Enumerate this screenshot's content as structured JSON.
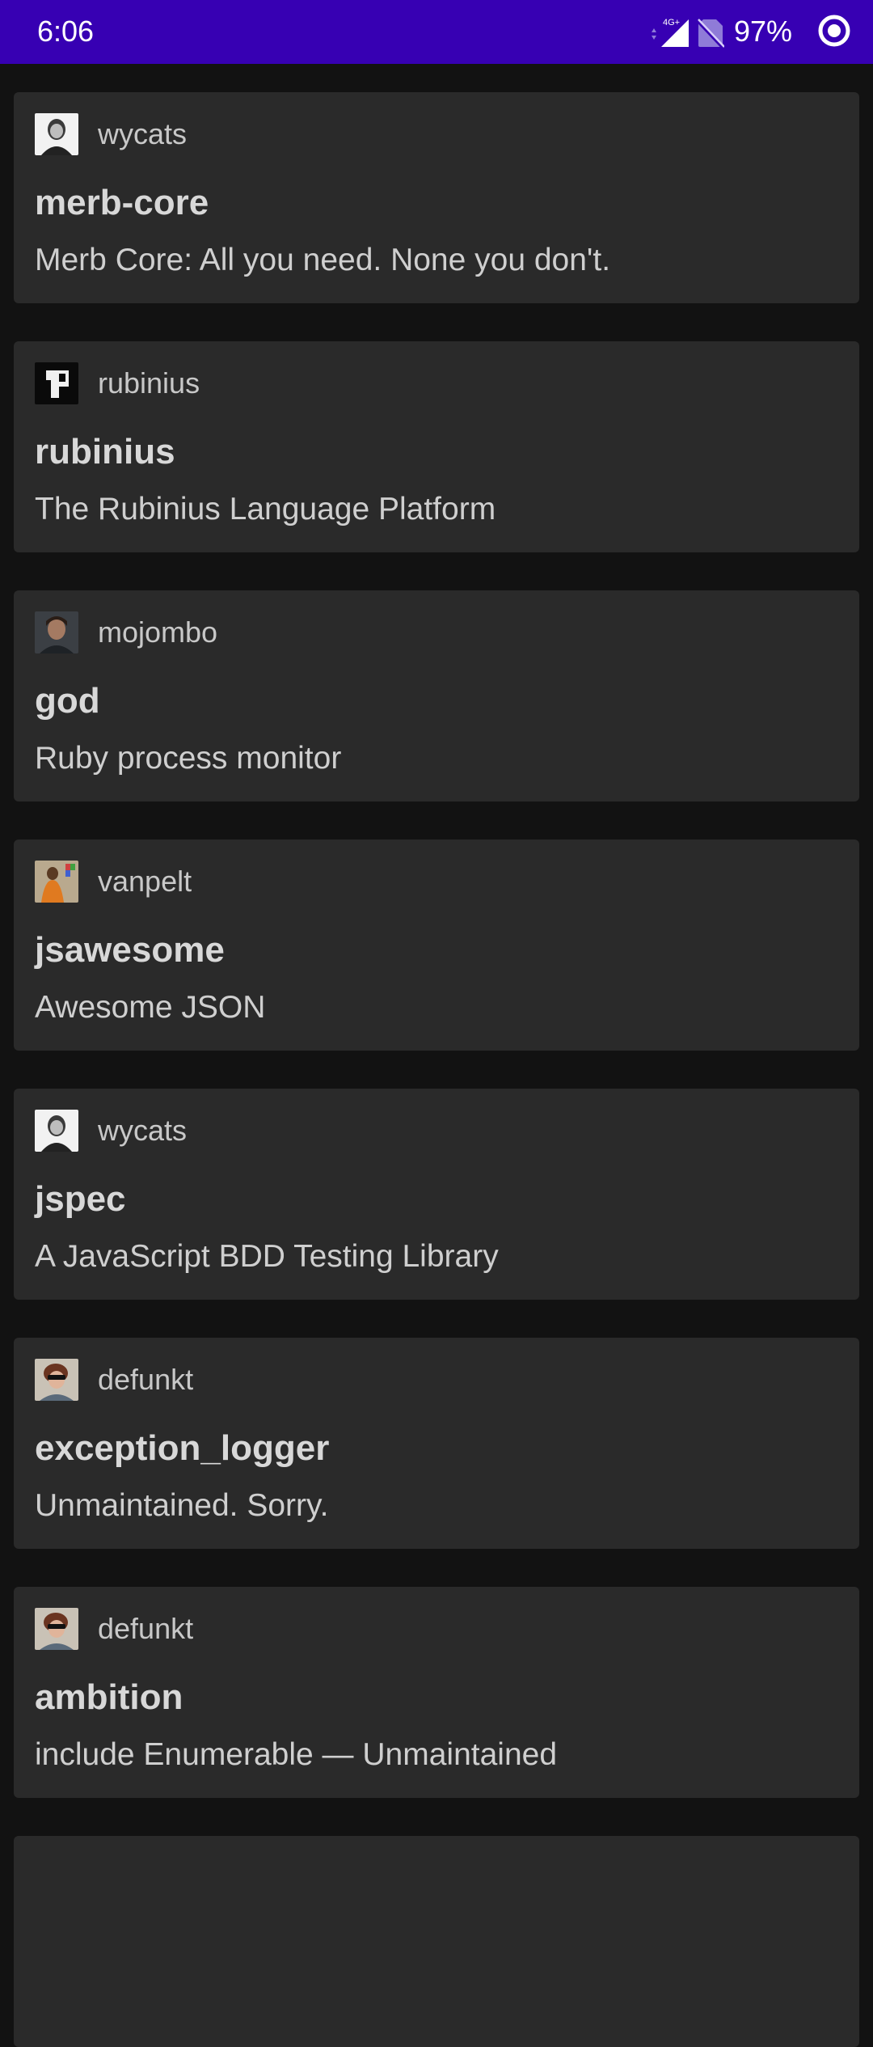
{
  "status_bar": {
    "time": "6:06",
    "network_label": "4G+",
    "battery_percent": "97%",
    "icons": [
      "signal-icon",
      "sim-off-icon",
      "ring-icon"
    ]
  },
  "repos": [
    {
      "owner": "wycats",
      "name": "merb-core",
      "description": "Merb Core: All you need. None you don't.",
      "avatar_icon": "wycats-avatar"
    },
    {
      "owner": "rubinius",
      "name": "rubinius",
      "description": "The Rubinius Language Platform",
      "avatar_icon": "rubinius-avatar"
    },
    {
      "owner": "mojombo",
      "name": "god",
      "description": "Ruby process monitor",
      "avatar_icon": "mojombo-avatar"
    },
    {
      "owner": "vanpelt",
      "name": "jsawesome",
      "description": "Awesome JSON",
      "avatar_icon": "vanpelt-avatar"
    },
    {
      "owner": "wycats",
      "name": "jspec",
      "description": "A JavaScript BDD Testing Library",
      "avatar_icon": "wycats-avatar"
    },
    {
      "owner": "defunkt",
      "name": "exception_logger",
      "description": "Unmaintained. Sorry.",
      "avatar_icon": "defunkt-avatar"
    },
    {
      "owner": "defunkt",
      "name": "ambition",
      "description": "include Enumerable — Unmaintained",
      "avatar_icon": "defunkt-avatar"
    }
  ]
}
